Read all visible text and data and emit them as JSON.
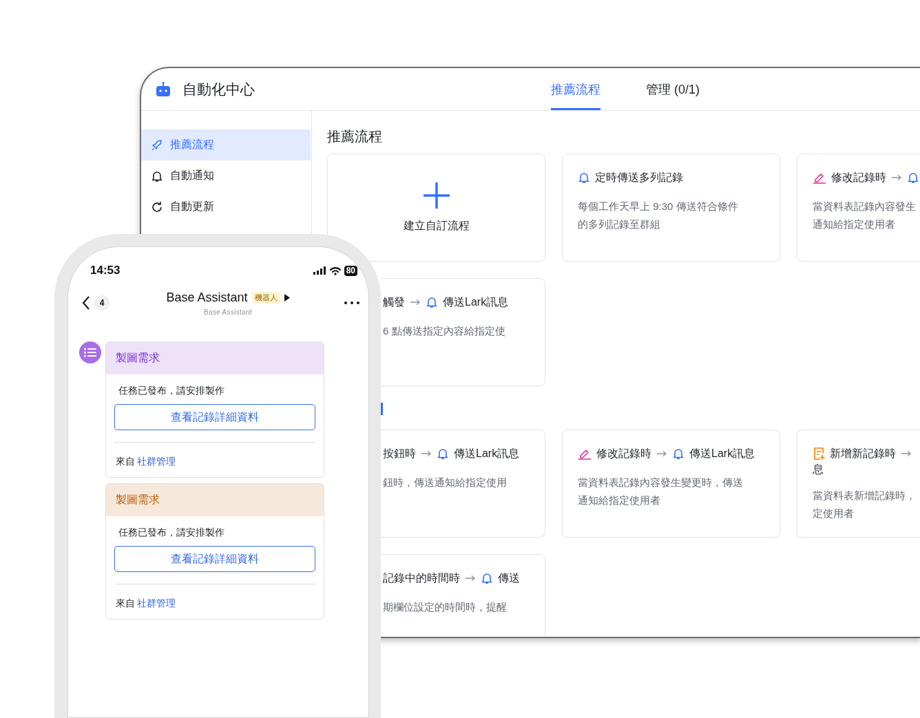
{
  "tablet": {
    "app_title": "自動化中心",
    "tabs": [
      {
        "label": "推薦流程",
        "selected": true
      },
      {
        "label": "管理 (0/1)",
        "selected": false
      }
    ],
    "sidebar": {
      "items": [
        {
          "label": "推薦流程",
          "selected": true
        },
        {
          "label": "自動通知",
          "selected": false
        },
        {
          "label": "自動更新",
          "selected": false
        }
      ]
    },
    "sections": [
      {
        "title": "推薦流程",
        "rows": [
          [
            {
              "kind": "create",
              "label": "建立自訂流程"
            },
            {
              "kind": "schedule",
              "trigger": "定時傳送多列記錄",
              "description_lines": [
                "每個工作天早上 9:30 傳送符合條件",
                "的多列記錄至群組"
              ]
            },
            {
              "kind": "edit",
              "trigger": "修改記錄時",
              "description_lines": [
                "當資料表記錄內容發生",
                "通知給指定使用者"
              ]
            }
          ],
          [
            {
              "kind": "generic",
              "trigger": "觸發",
              "action": "傳送Lark訊息",
              "description_lines": [
                "6 點傳送指定內容給指定使"
              ]
            }
          ]
        ]
      },
      {
        "rows": [
          [
            {
              "kind": "generic",
              "trigger": "按鈕時",
              "action": "傳送Lark訊息",
              "description_lines": [
                "鈕時，傳送通知給指定使用"
              ]
            },
            {
              "kind": "edit",
              "trigger": "修改記錄時",
              "action": "傳送Lark訊息",
              "description_lines": [
                "當資料表記錄內容發生變更時，傳送",
                "通知給指定使用者"
              ]
            },
            {
              "kind": "add",
              "trigger": "新增新記錄時",
              "action": "息",
              "description_lines": [
                "當資料表新增記錄時，",
                "定使用者"
              ]
            }
          ],
          [
            {
              "kind": "generic",
              "trigger": "記錄中的時間時",
              "action": "傳送",
              "description_lines": [
                "期欄位設定的時間時，提醒"
              ]
            }
          ]
        ]
      }
    ]
  },
  "phone": {
    "status_bar": {
      "time": "14:53",
      "battery": "80"
    },
    "header": {
      "unread_count": "4",
      "title": "Base Assistant",
      "tag": "機器人",
      "subtitle": "Base Assistant"
    },
    "messages": [
      {
        "color": "#7b2fd0",
        "title": "製圖需求",
        "body": "任務已發布，請安排製作",
        "button": "查看記錄詳細資料",
        "source_prefix": "來自",
        "source_link": "社群管理"
      },
      {
        "color": "#c05a00",
        "title": "製圖需求",
        "body": "任務已發布，請安排製作",
        "button": "查看記錄詳細資料",
        "source_prefix": "來自",
        "source_link": "社群管理"
      }
    ]
  }
}
